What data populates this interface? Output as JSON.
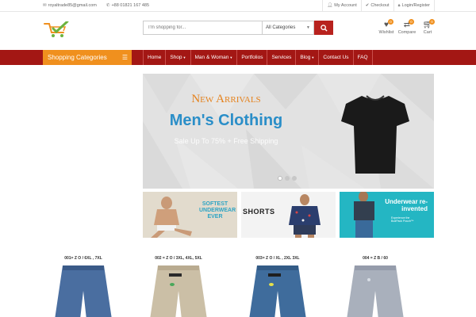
{
  "topbar": {
    "email": "royaltrade85@gmail.com",
    "phone": "+88 01821 167 485",
    "links": [
      {
        "name": "my-account-link",
        "icon": "user-icon",
        "label": "My Account"
      },
      {
        "name": "checkout-link",
        "icon": "check-icon",
        "label": "Checkout"
      },
      {
        "name": "login-register-link",
        "icon": "lock-icon",
        "label": "Login/Register"
      }
    ]
  },
  "search": {
    "placeholder": "I'm shopping for...",
    "category": "All Categories"
  },
  "header_icons": [
    {
      "name": "wishlist",
      "label": "Wishlist",
      "count": "0"
    },
    {
      "name": "compare",
      "label": "Compare",
      "count": "0"
    },
    {
      "name": "cart",
      "label": "Cart",
      "count": "0"
    }
  ],
  "nav": {
    "shopping_categories": "Shopping Categories",
    "menu": [
      {
        "label": "Home",
        "dropdown": false
      },
      {
        "label": "Shop",
        "dropdown": true
      },
      {
        "label": "Man & Woman",
        "dropdown": true
      },
      {
        "label": "Portfolios",
        "dropdown": false
      },
      {
        "label": "Services",
        "dropdown": false
      },
      {
        "label": "Blog",
        "dropdown": true
      },
      {
        "label": "Contact Us",
        "dropdown": false
      },
      {
        "label": "FAQ",
        "dropdown": false
      }
    ]
  },
  "banner": {
    "kicker": "New Arrivals",
    "headline": "Men's Clothing",
    "sub": "Sale Up To 75% + Free Shipping"
  },
  "promos": {
    "p1": "SOFTEST UNDERWEAR EVER",
    "p2": "SHORTS",
    "p3_title": "Underwear re-invented",
    "p3_sub": "Experience the BodPack Pouch™"
  },
  "products": [
    {
      "title": "001= Z O / 6XL , 7XL",
      "color": "#4a6ea0"
    },
    {
      "title": "002 = Z O / 3XL, 4XL, 5XL",
      "color": "#cbbfa6"
    },
    {
      "title": "003= Z O / XL , 2XL 3XL",
      "color": "#3f6c9c"
    },
    {
      "title": "004 = Z B / 60",
      "color": "#a9b0bc"
    }
  ],
  "colors": {
    "brand_red": "#a31714",
    "accent_orange": "#f0901e",
    "link_blue": "#2a8ec8"
  }
}
